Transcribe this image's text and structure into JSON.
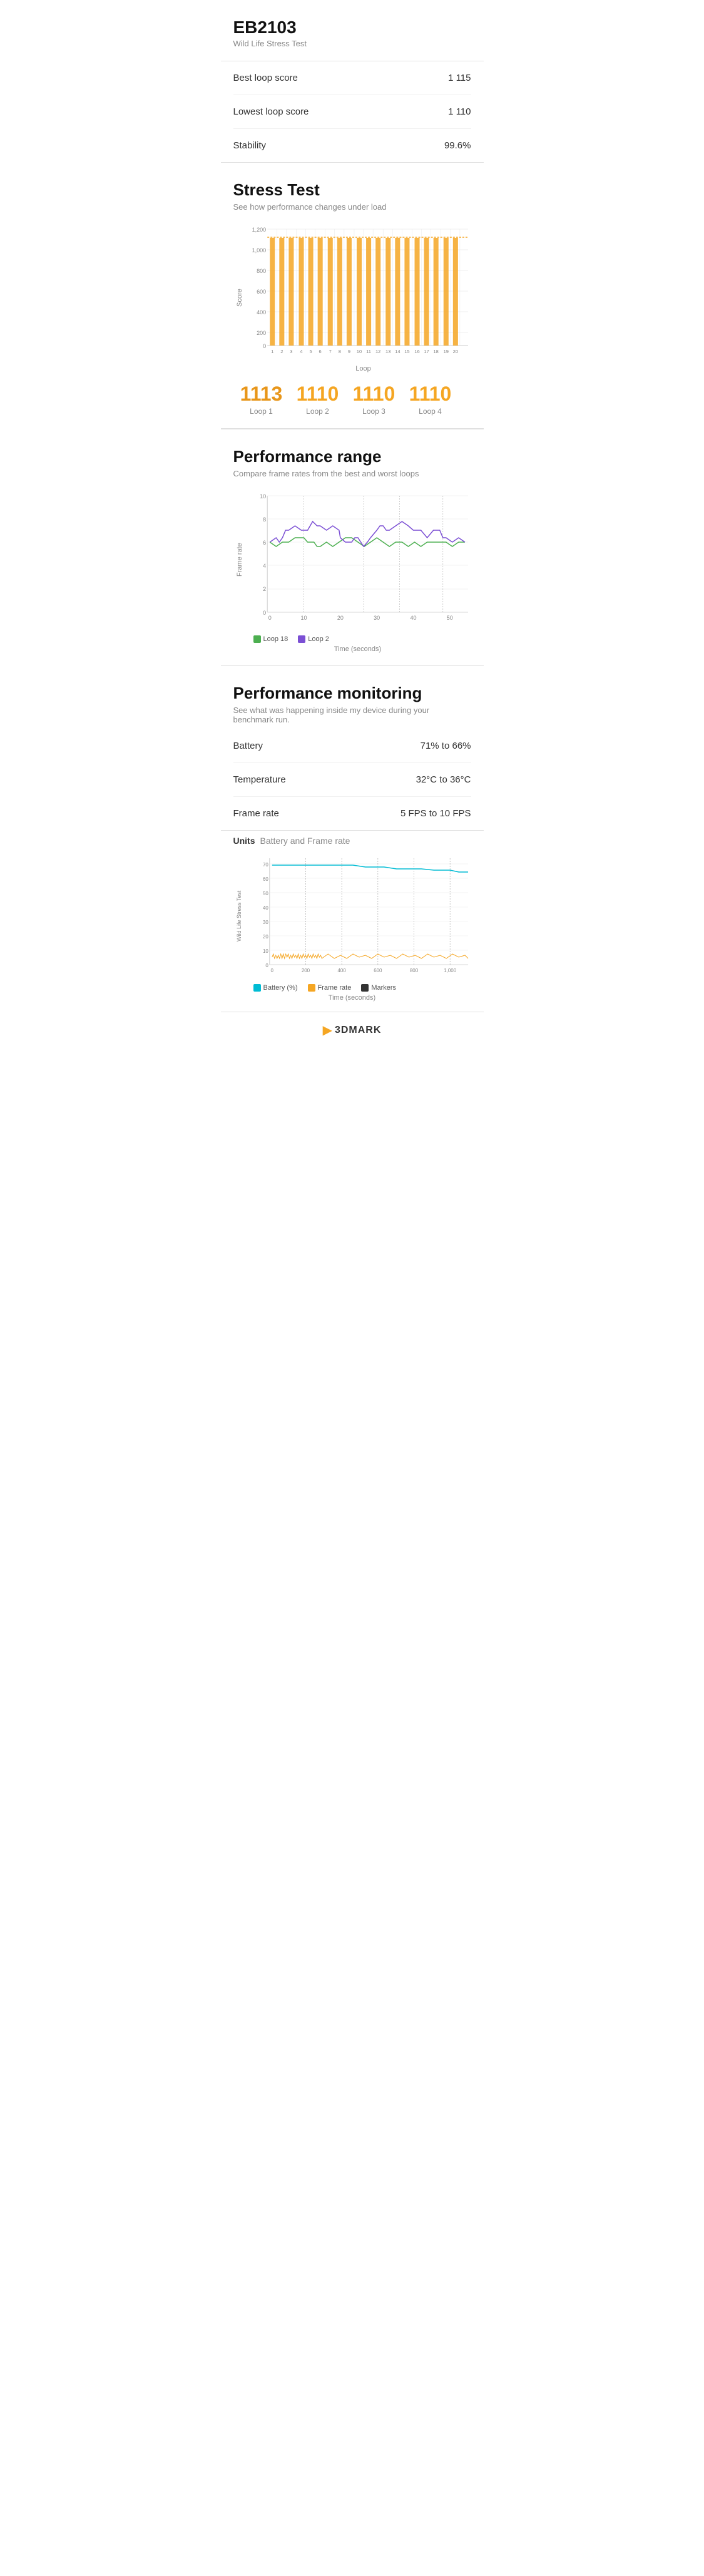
{
  "header": {
    "device_name": "EB2103",
    "test_name": "Wild Life Stress Test"
  },
  "stats": [
    {
      "label": "Best loop score",
      "value": "1 115"
    },
    {
      "label": "Lowest loop score",
      "value": "1 110"
    },
    {
      "label": "Stability",
      "value": "99.6%"
    }
  ],
  "stress_test": {
    "title": "Stress Test",
    "description": "See how performance changes under load",
    "y_axis_label": "Score",
    "x_axis_label": "Loop",
    "y_ticks": [
      "1,200",
      "1,000",
      "800",
      "600",
      "400",
      "200",
      "0"
    ],
    "x_ticks": [
      "1",
      "2",
      "3",
      "4",
      "5",
      "6",
      "7",
      "8",
      "9",
      "10",
      "11",
      "12",
      "13",
      "14",
      "15",
      "16",
      "17",
      "18",
      "19",
      "20"
    ],
    "loop_scores": [
      {
        "value": "1113",
        "label": "Loop 1",
        "is_best": true
      },
      {
        "value": "1110",
        "label": "Loop 2",
        "is_best": false
      },
      {
        "value": "1110",
        "label": "Loop 3",
        "is_best": false
      },
      {
        "value": "1110",
        "label": "Loop 4",
        "is_best": false
      }
    ]
  },
  "performance_range": {
    "title": "Performance range",
    "description": "Compare frame rates from the best and worst loops",
    "y_axis_label": "Frame rate",
    "x_axis_label": "Time (seconds)",
    "y_ticks": [
      "10",
      "8",
      "6",
      "4",
      "2",
      "0"
    ],
    "x_ticks": [
      "0",
      "10",
      "20",
      "30",
      "40",
      "50"
    ],
    "legend": [
      {
        "label": "Loop 18",
        "color": "#4caf50"
      },
      {
        "label": "Loop 2",
        "color": "#7b4fd4"
      }
    ]
  },
  "performance_monitoring": {
    "title": "Performance monitoring",
    "description": "See what was happening inside my device during your benchmark run.",
    "stats": [
      {
        "label": "Battery",
        "value": "71% to 66%"
      },
      {
        "label": "Temperature",
        "value": "32°C to 36°C"
      },
      {
        "label": "Frame rate",
        "value": "5 FPS to 10 FPS"
      }
    ],
    "units_label": "Units",
    "units_value": "Battery and Frame rate",
    "y_axis_label": "Wild Life Stress Test",
    "x_axis_label": "Time (seconds)",
    "y_ticks": [
      "70",
      "60",
      "50",
      "40",
      "30",
      "20",
      "10",
      "0"
    ],
    "x_ticks": [
      "0",
      "200",
      "400",
      "600",
      "800",
      "1,000"
    ],
    "legend": [
      {
        "label": "Battery (%)",
        "color": "#00bcd4"
      },
      {
        "label": "Frame rate",
        "color": "#f5a623"
      },
      {
        "label": "Markers",
        "color": "#333"
      }
    ]
  },
  "footer": {
    "logo_text": "3DMARK"
  }
}
